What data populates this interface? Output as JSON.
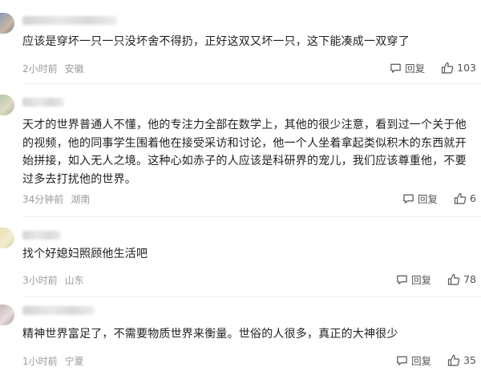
{
  "comments": [
    {
      "text": "应该是穿坏一只一只没坏舍不得扔，正好这双又坏一只，这下能凑成一双穿了",
      "time": "2小时前",
      "location": "安徽",
      "reply_label": "回复",
      "likes": "103"
    },
    {
      "text": "天才的世界普通人不懂，他的专注力全部在数学上，其他的很少注意，看到过一个关于他的视频，他的同事学生围着他在接受采访和讨论，他一个人坐着拿起类似积木的东西就开始拼接，如入无人之境。这种心如赤子的人应该是科研界的宠儿，我们应该尊重他，不要过多去打扰他的世界。",
      "time": "34分钟前",
      "location": "湖南",
      "reply_label": "回复",
      "likes": "6"
    },
    {
      "text": "找个好媳妇照顾他生活吧",
      "time": "3小时前",
      "location": "山东",
      "reply_label": "回复",
      "likes": "78"
    },
    {
      "text": "精神世界富足了，不需要物质世界来衡量。世俗的人很多，真正的大神很少",
      "time": "1小时前",
      "location": "宁夏",
      "reply_label": "回复",
      "likes": "35"
    }
  ],
  "colors": {
    "text": "#222222",
    "meta": "#9a9a9a",
    "action": "#555555"
  },
  "icons": [
    "comment-bubble-icon",
    "thumbs-up-icon"
  ]
}
